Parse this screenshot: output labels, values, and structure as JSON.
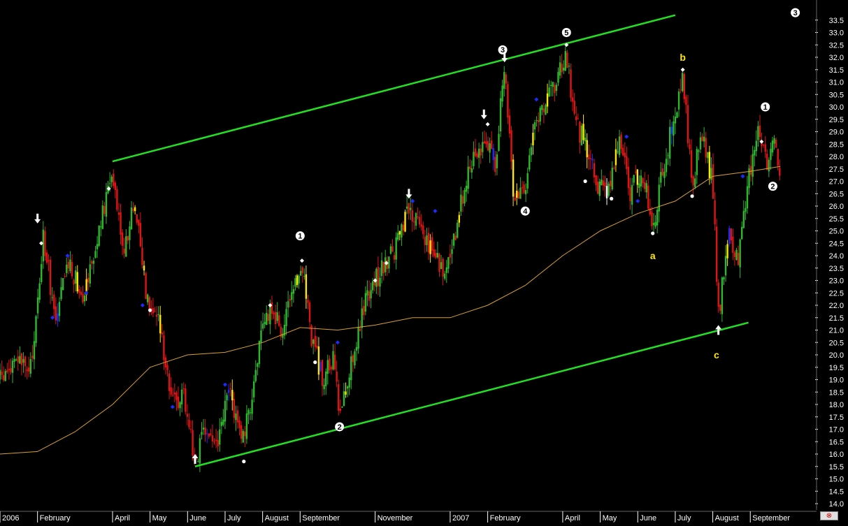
{
  "chart_data": {
    "type": "candlestick",
    "title": "",
    "xlabel": "",
    "ylabel": "",
    "ylim": [
      14.0,
      34.0
    ],
    "yticks": [
      "14.0",
      "14.5",
      "15.0",
      "15.5",
      "16.0",
      "16.5",
      "17.0",
      "17.5",
      "18.0",
      "18.5",
      "19.0",
      "19.5",
      "20.0",
      "20.5",
      "21.0",
      "21.5",
      "22.0",
      "22.5",
      "23.0",
      "23.5",
      "24.0",
      "24.5",
      "25.0",
      "25.5",
      "26.0",
      "26.5",
      "27.0",
      "27.5",
      "28.0",
      "28.5",
      "29.0",
      "29.5",
      "30.0",
      "30.5",
      "31.0",
      "31.5",
      "32.0",
      "32.5",
      "33.0",
      "33.5"
    ],
    "xlabels": [
      "2006",
      "February",
      "April",
      "May",
      "June",
      "July",
      "August",
      "September",
      "November",
      "2007",
      "February",
      "April",
      "May",
      "June",
      "July",
      "August",
      "September"
    ],
    "xlim_months": [
      0,
      21.3
    ],
    "xlabel_months": [
      0,
      1,
      3,
      4,
      5,
      6,
      7,
      8,
      10,
      12,
      13,
      15,
      16,
      17,
      18,
      19,
      20
    ],
    "price_path": [
      [
        0.0,
        19.0
      ],
      [
        0.5,
        19.8
      ],
      [
        0.8,
        19.2
      ],
      [
        1.0,
        22.0
      ],
      [
        1.15,
        24.8
      ],
      [
        1.3,
        23.3
      ],
      [
        1.5,
        21.2
      ],
      [
        1.8,
        23.8
      ],
      [
        2.2,
        22.5
      ],
      [
        2.6,
        24.6
      ],
      [
        3.0,
        27.5
      ],
      [
        3.3,
        24.2
      ],
      [
        3.6,
        26.2
      ],
      [
        3.9,
        22.5
      ],
      [
        4.2,
        21.5
      ],
      [
        4.4,
        20.0
      ],
      [
        4.6,
        18.0
      ],
      [
        4.9,
        18.5
      ],
      [
        5.2,
        15.7
      ],
      [
        5.5,
        17.0
      ],
      [
        5.8,
        16.3
      ],
      [
        6.1,
        18.6
      ],
      [
        6.5,
        16.5
      ],
      [
        6.9,
        20.2
      ],
      [
        7.2,
        22.0
      ],
      [
        7.5,
        21.0
      ],
      [
        7.8,
        22.2
      ],
      [
        8.05,
        23.8
      ],
      [
        8.3,
        20.8
      ],
      [
        8.6,
        19.0
      ],
      [
        8.9,
        19.8
      ],
      [
        9.05,
        17.5
      ],
      [
        9.4,
        20.0
      ],
      [
        9.8,
        22.5
      ],
      [
        10.2,
        23.5
      ],
      [
        10.6,
        24.5
      ],
      [
        10.9,
        25.8
      ],
      [
        11.2,
        25.2
      ],
      [
        11.6,
        24.0
      ],
      [
        11.9,
        23.3
      ],
      [
        12.2,
        25.3
      ],
      [
        12.5,
        27.8
      ],
      [
        12.9,
        28.6
      ],
      [
        13.2,
        27.8
      ],
      [
        13.45,
        31.5
      ],
      [
        13.7,
        26.3
      ],
      [
        14.0,
        26.8
      ],
      [
        14.2,
        29.2
      ],
      [
        14.6,
        30.2
      ],
      [
        14.9,
        31.3
      ],
      [
        15.1,
        32.1
      ],
      [
        15.3,
        29.5
      ],
      [
        15.6,
        28.5
      ],
      [
        15.9,
        27.0
      ],
      [
        16.2,
        26.5
      ],
      [
        16.5,
        28.8
      ],
      [
        16.8,
        26.5
      ],
      [
        17.1,
        27.5
      ],
      [
        17.4,
        25.2
      ],
      [
        17.7,
        27.6
      ],
      [
        18.0,
        29.8
      ],
      [
        18.2,
        31.2
      ],
      [
        18.45,
        27.0
      ],
      [
        18.7,
        28.8
      ],
      [
        19.0,
        27.0
      ],
      [
        19.15,
        21.5
      ],
      [
        19.4,
        24.8
      ],
      [
        19.7,
        24.0
      ],
      [
        19.95,
        27.0
      ],
      [
        20.2,
        29.3
      ],
      [
        20.5,
        27.5
      ],
      [
        20.6,
        28.8
      ],
      [
        20.8,
        27.5
      ]
    ],
    "moving_average": [
      [
        0.0,
        16.0
      ],
      [
        1.0,
        16.1
      ],
      [
        2.0,
        16.9
      ],
      [
        3.0,
        18.0
      ],
      [
        4.0,
        19.5
      ],
      [
        5.0,
        20.0
      ],
      [
        6.0,
        20.1
      ],
      [
        7.0,
        20.5
      ],
      [
        8.0,
        21.1
      ],
      [
        9.0,
        21.0
      ],
      [
        10.0,
        21.2
      ],
      [
        11.0,
        21.5
      ],
      [
        12.0,
        21.5
      ],
      [
        13.0,
        22.0
      ],
      [
        14.0,
        22.8
      ],
      [
        15.0,
        24.0
      ],
      [
        16.0,
        25.0
      ],
      [
        17.0,
        25.7
      ],
      [
        18.0,
        26.2
      ],
      [
        19.0,
        27.2
      ],
      [
        20.0,
        27.4
      ],
      [
        20.8,
        27.6
      ]
    ],
    "channel_lines": [
      [
        [
          3.0,
          27.8
        ],
        [
          18.0,
          33.7
        ]
      ],
      [
        [
          5.2,
          15.5
        ],
        [
          19.95,
          21.3
        ]
      ]
    ],
    "wave_labels": [
      {
        "text": "1",
        "style": "circled",
        "x": 8.0,
        "y": 24.8
      },
      {
        "text": "2",
        "style": "circled",
        "x": 9.05,
        "y": 17.1
      },
      {
        "text": "3",
        "style": "circled",
        "x": 13.4,
        "y": 32.3
      },
      {
        "text": "4",
        "style": "circled",
        "x": 14.0,
        "y": 25.8
      },
      {
        "text": "5",
        "style": "circled",
        "x": 15.1,
        "y": 33.0
      },
      {
        "text": "1",
        "style": "circled",
        "x": 20.4,
        "y": 30.0
      },
      {
        "text": "2",
        "style": "circled",
        "x": 20.6,
        "y": 26.8
      },
      {
        "text": "3",
        "style": "circled",
        "x": 21.2,
        "y": 33.8
      },
      {
        "text": "a",
        "style": "yellow",
        "x": 17.4,
        "y": 24.0
      },
      {
        "text": "b",
        "style": "yellow",
        "x": 18.2,
        "y": 32.0
      },
      {
        "text": "c",
        "style": "yellow",
        "x": 19.1,
        "y": 20.0
      }
    ],
    "markers": [
      {
        "kind": "arrow-down",
        "x": 1.0,
        "y": 25.3
      },
      {
        "kind": "arrow-down",
        "x": 10.9,
        "y": 26.3
      },
      {
        "kind": "arrow-down",
        "x": 12.9,
        "y": 29.5
      },
      {
        "kind": "arrow-down",
        "x": 13.45,
        "y": 31.8
      },
      {
        "kind": "arrow-up",
        "x": 5.2,
        "y": 16.0
      },
      {
        "kind": "arrow-up",
        "x": 19.15,
        "y": 21.2
      },
      {
        "kind": "diamond",
        "x": 1.1,
        "y": 24.5
      },
      {
        "kind": "diamond",
        "x": 2.9,
        "y": 26.7
      },
      {
        "kind": "diamond",
        "x": 7.2,
        "y": 22.0
      },
      {
        "kind": "diamond",
        "x": 8.05,
        "y": 23.8
      },
      {
        "kind": "diamond",
        "x": 10.0,
        "y": 23.0
      },
      {
        "kind": "diamond",
        "x": 10.3,
        "y": 23.7
      },
      {
        "kind": "diamond",
        "x": 13.0,
        "y": 29.3
      },
      {
        "kind": "diamond",
        "x": 15.1,
        "y": 32.5
      },
      {
        "kind": "diamond",
        "x": 18.2,
        "y": 31.5
      },
      {
        "kind": "diamond",
        "x": 20.3,
        "y": 28.6
      },
      {
        "kind": "blue",
        "x": 1.4,
        "y": 21.5
      },
      {
        "kind": "blue",
        "x": 1.8,
        "y": 24.0
      },
      {
        "kind": "blue",
        "x": 2.3,
        "y": 22.5
      },
      {
        "kind": "blue",
        "x": 3.8,
        "y": 22.0
      },
      {
        "kind": "blue",
        "x": 4.6,
        "y": 17.9
      },
      {
        "kind": "blue",
        "x": 6.0,
        "y": 18.8
      },
      {
        "kind": "blue",
        "x": 9.0,
        "y": 20.5
      },
      {
        "kind": "blue",
        "x": 11.0,
        "y": 26.2
      },
      {
        "kind": "blue",
        "x": 11.6,
        "y": 25.8
      },
      {
        "kind": "blue",
        "x": 14.3,
        "y": 30.3
      },
      {
        "kind": "blue",
        "x": 16.7,
        "y": 28.8
      },
      {
        "kind": "blue",
        "x": 17.0,
        "y": 26.2
      },
      {
        "kind": "blue",
        "x": 19.8,
        "y": 27.2
      },
      {
        "kind": "dot",
        "x": 4.0,
        "y": 21.8
      },
      {
        "kind": "dot",
        "x": 6.5,
        "y": 15.7
      },
      {
        "kind": "dot",
        "x": 8.4,
        "y": 19.7
      },
      {
        "kind": "dot",
        "x": 15.6,
        "y": 27.0
      },
      {
        "kind": "dot",
        "x": 16.3,
        "y": 26.3
      },
      {
        "kind": "dot",
        "x": 17.4,
        "y": 24.9
      },
      {
        "kind": "dot",
        "x": 18.45,
        "y": 26.4
      }
    ],
    "colors": {
      "background": "#000000",
      "candle_up": "#2db82d",
      "candle_down": "#e01414",
      "highlight_yellow": "#ffe600",
      "highlight_blue": "#1a2cff",
      "moving_average": "#d8a030",
      "channel": "#22e022",
      "axis_text": "#ffffff",
      "wave_label_yellow": "#ffe600"
    }
  }
}
